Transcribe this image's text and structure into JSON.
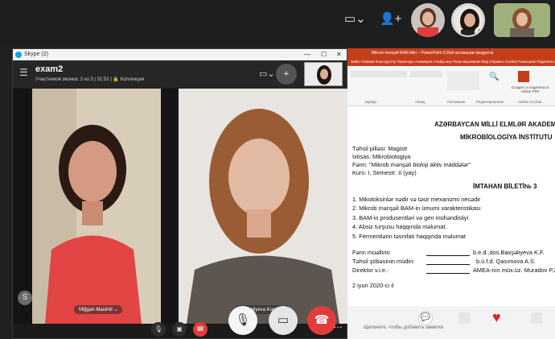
{
  "outer_call": {
    "layout_icon": "layout-icon",
    "add_people_icon": "add-person-icon"
  },
  "skype_window": {
    "title": "Skype (2)",
    "call_name": "exam2",
    "call_subtitle": "Участников звонка: 3 из 3 | 31:52 | 🔒 Коллекция",
    "participants": [
      {
        "label": "Miğgan Masimli ⌄"
      },
      {
        "label": "Baxşəliyeva Konul ⌄"
      }
    ]
  },
  "ppt_window": {
    "title_bar": "Mikrob mənşəli BAM ilkin ~ PowerPoint (Сбой активации продукта)",
    "tabs": "Файл  Главная  Конструктор  Переходы  Анимация  Слайд-шоу  Рецензирование  Вид  Справка  Acrobat  Помощник  Поделиться",
    "ribbon_groups": [
      "Шрифт",
      "Абзац",
      "Рисование",
      "Редактирование",
      "Adobe Acrobat"
    ],
    "ribbon_button": "Создать и поделиться Adobe PDF",
    "status_placeholder": "Щелкните, чтобы добавить заметки"
  },
  "document": {
    "heading1": "AZƏRBAYCAN MİLLİ ELMLƏR AKADEMİYASI",
    "heading2": "MİKROBİOLOGİYA İNSTİTUTU",
    "degree": "Təhsil pilləsi: Magistr",
    "specialty": "İxtisas: Mikrobiologiya",
    "subject": "Fənn: \"Mikrob mənşəli bioloji aktiv maddələr\"",
    "course": "Kurs: I, Semestr: II (yay)",
    "ticket_title": "İMTAHAN BİLETİ№ 3",
    "questions": [
      "1.  Mikotoksinlər nədir və təsir mexanizmi necədir",
      "2.  Mikrob mənşəli BAM-in ümumi xarakteristikası",
      "3.  BAM-in produsentləri və gen mühəndisliyi",
      "4.  Absiz turşusu haqqında məlumat.",
      "5.  Fermentlərin təsnifatı haqqında məlumat"
    ],
    "signatures": [
      {
        "role": "Fənn müəllimi:",
        "person": "b.e.d.,dos.Baxşəliyeva K.F."
      },
      {
        "role": "Təhsil şöbəsinin müdiri:",
        "person": "b.ü.f.d. Qasımova A.S."
      },
      {
        "role": "Direktor v.i.e.:",
        "person": "AMEA-nın müx.üz. Muradov P.Z."
      }
    ],
    "date": "2 iyun 2020-ci il"
  },
  "colors": {
    "ppt_accent": "#c43e1c",
    "hangup": "#e33b3b",
    "heart": "#e02020"
  }
}
